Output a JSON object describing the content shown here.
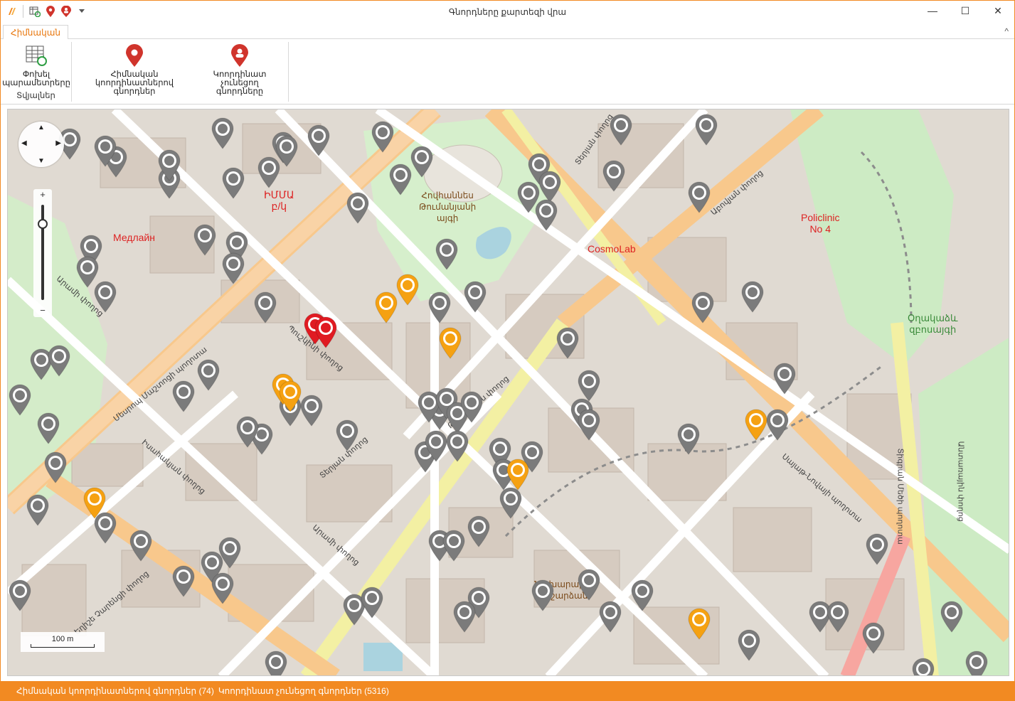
{
  "window": {
    "title": "Գնորդները քարտեզի վրա",
    "minimize": "—",
    "maximize": "☐",
    "close": "✕"
  },
  "qat": {
    "icons": [
      "app-logo-icon",
      "refresh-table-icon",
      "map-pin-icon",
      "user-pin-icon",
      "dropdown-arrow-icon"
    ]
  },
  "ribbon": {
    "tab_main": "Հիմնական",
    "collapse": "^",
    "group_data": {
      "label": "Տվյալներ",
      "change_params": "Փոխել\nպարամետրերը"
    },
    "group_actions": {
      "with_coords": "Հիմնական\nկոորդինատներով գնորդներ",
      "no_coords": "Կոորդինատ չունեցող\nգնորդները"
    }
  },
  "map": {
    "zoom_in": "+",
    "zoom_out": "−",
    "scale": "100 m",
    "labels": {
      "imma": "ԻՄՄԱ\nբ/կ",
      "medlain": "Медлайн",
      "cosmolab": "CosmoLab",
      "policlinic": "Policlinic\nNo 4",
      "park": "Հովհաննես\nԹումանյանի\nայգի",
      "lovers_park": "Օղակաձև\nզբոսայգի",
      "naxarar": "Նախարարի\nհուշարձան"
    },
    "streets": {
      "s1": "Մեսրոպ Մաշտոցի պողոտա",
      "s2": "Արամի փողոց",
      "s3": "Տերյան փողոց",
      "s4": "Պուշկինի փողոց",
      "s5": "Սայաթ-Նովայի պողոտա",
      "s6": "Աբովյան փողոց",
      "s7": "Արամի փողոց",
      "s8": "Թումանյան փողոց",
      "s9": "Իսահակյան փողոց",
      "s10": "Տիգրան Մեծի պողոտա",
      "s11": "Եղիշե Չարենցի փողոց",
      "s12": "Տերյան փողոց",
      "s13": "Անտառային փողոց"
    },
    "colors": {
      "gray_pin": "#7b7b7b",
      "orange_pin": "#f5a112",
      "red_pin": "#e01b22",
      "roads_main": "#f9c98f",
      "roads_yellow": "#f4f2a8",
      "park_green": "#cdebc4",
      "building": "#d3c8bc"
    },
    "pins": {
      "gray_count_visible": 96,
      "orange_count_visible": 9,
      "red_count_visible": 2
    }
  },
  "status": {
    "with_coords": "Հիմնական կոորդինատներով գնորդներ (74)",
    "no_coords": "Կոորդինատ չունեցող գնորդներ (5316)"
  }
}
